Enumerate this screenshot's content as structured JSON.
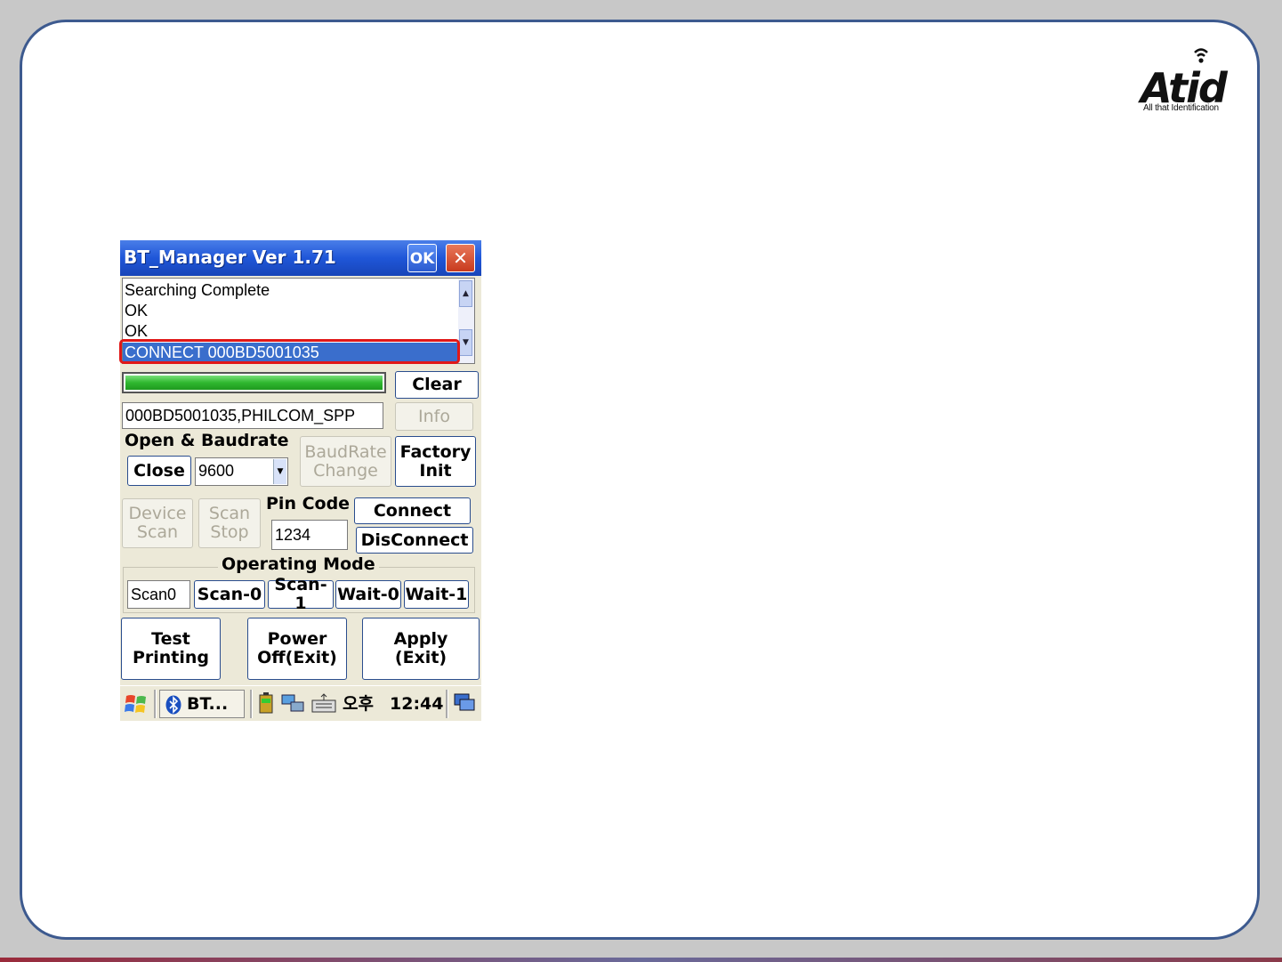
{
  "logo": {
    "word": "Atid",
    "tagline": "All that Identification"
  },
  "window": {
    "title": "BT_Manager Ver 1.71",
    "ok_label": "OK",
    "close_label": "✕"
  },
  "log": {
    "lines": [
      "Searching Complete",
      "OK",
      "OK",
      "CONNECT 000BD5001035"
    ],
    "selected_index": 3
  },
  "progress": {
    "value": 1.0
  },
  "buttons": {
    "clear": "Clear",
    "info": "Info",
    "close": "Close",
    "baudrate_change": "BaudRate\nChange",
    "factory_init": "Factory\nInit",
    "device_scan": "Device\nScan",
    "scan_stop": "Scan\nStop",
    "connect": "Connect",
    "disconnect": "DisConnect",
    "scan0": "Scan-0",
    "scan1": "Scan-1",
    "wait0": "Wait-0",
    "wait1": "Wait-1",
    "test_printing": "Test\nPrinting",
    "power_off": "Power\nOff(Exit)",
    "apply": "Apply\n(Exit)"
  },
  "device_field": "000BD5001035,PHILCOM_SPP",
  "labels": {
    "open_baudrate": "Open & Baudrate",
    "pin_code": "Pin Code",
    "operating_mode": "Operating Mode"
  },
  "baudrate": {
    "selected": "9600"
  },
  "pin_code": {
    "value": "1234"
  },
  "operating_mode": {
    "current": "Scan0"
  },
  "taskbar": {
    "task": "BT...",
    "time_prefix": "오후",
    "time": "12:44"
  },
  "colors": {
    "accent": "#1f56d8",
    "highlight": "#e01818",
    "progress": "#2fb82f"
  }
}
